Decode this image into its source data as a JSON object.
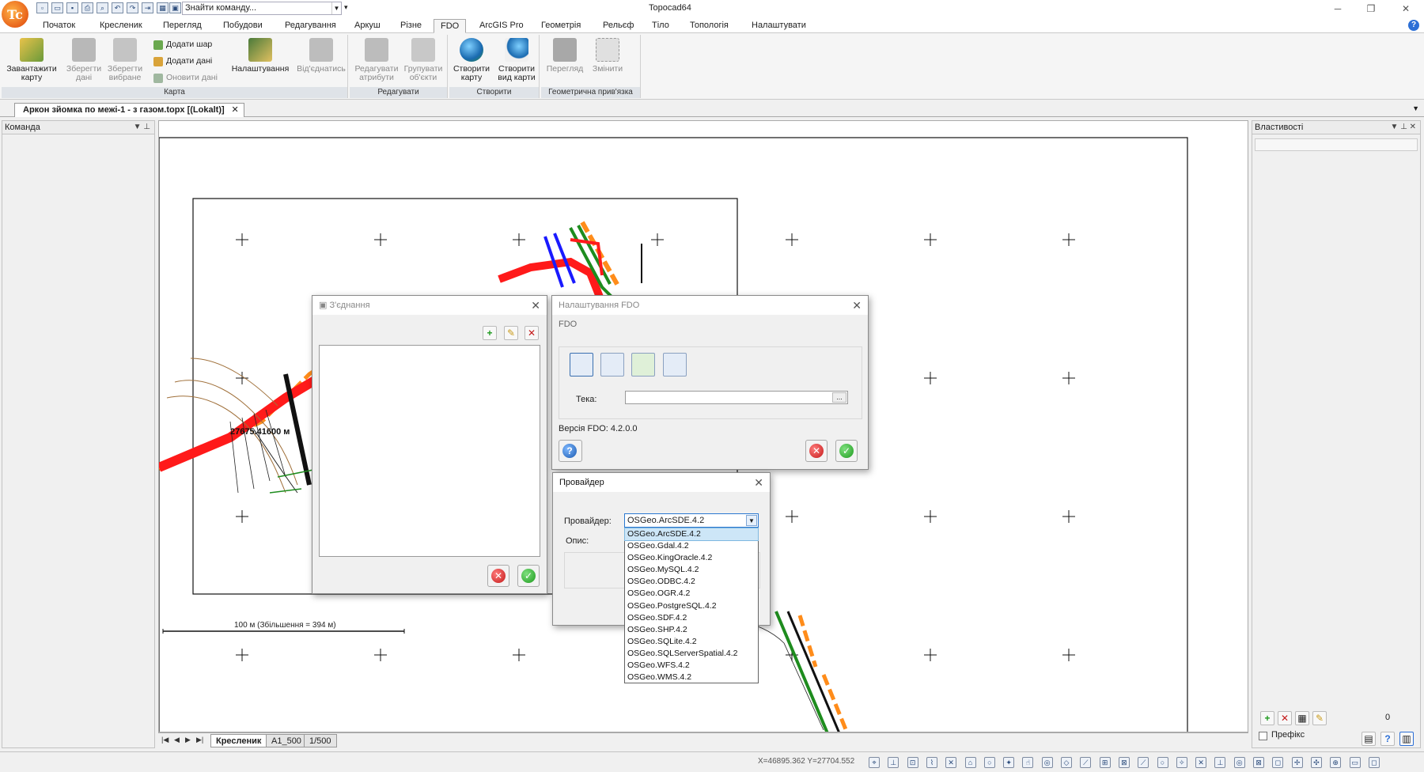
{
  "app": {
    "title": "Topocad64",
    "logo_text": "Tc",
    "search_placeholder": "Знайти команду..."
  },
  "menu": [
    "Початок",
    "Кресленик",
    "Перегляд",
    "Побудови",
    "Редагування",
    "Аркуш",
    "Різне",
    "FDO",
    "ArcGIS Pro",
    "Геометрія",
    "Рельєф",
    "Тіло",
    "Топологія",
    "Налаштувати"
  ],
  "ribbon": {
    "karta": {
      "caption": "Карта",
      "load": "Завантажити карту",
      "save_data": "Зберегти дані",
      "save_selected": "Зберегти вибране",
      "add_layer": "Додати шар",
      "add_data": "Додати дані",
      "refresh_data": "Оновити дані",
      "settings": "Налаштування",
      "disconnect": "Від'єднатись"
    },
    "edit": {
      "caption": "Редагувати",
      "edit_attrs": "Редагувати атрибути",
      "group_objects": "Групувати об'єкти"
    },
    "create": {
      "caption": "Створити",
      "create_map": "Створити карту",
      "create_map_view": "Створити вид карти"
    },
    "georef": {
      "caption": "Геометрична прив'язка",
      "view": "Перегляд",
      "change": "Змінити"
    }
  },
  "document_tab": "Аркон зйомка по межі-1 - з газом.topx [(Lokalt)]",
  "left_panel": {
    "title": "Команда"
  },
  "right_panel": {
    "title": "Властивості",
    "count": "0",
    "prefix_label": "Префікс"
  },
  "canvas": {
    "scale_text": "100 м (Збільшення = 394 м)",
    "annotation": "27675.41600 м",
    "sheet_tabs": [
      "Кресленик",
      "A1_500",
      "1/500"
    ]
  },
  "status": {
    "coords": "X=46895.362 Y=27704.552"
  },
  "dialog_connections": {
    "title": "З'єднання"
  },
  "dialog_fdo": {
    "title": "Налаштування FDO",
    "section": "FDO",
    "folder_label": "Тека:",
    "folder_value": "",
    "browse": "...",
    "version": "Версія FDO: 4.2.0.0"
  },
  "dialog_provider": {
    "title": "Провайдер",
    "provider_label": "Провайдер:",
    "description_label": "Опис:",
    "selected": "OSGeo.ArcSDE.4.2",
    "options": [
      "OSGeo.ArcSDE.4.2",
      "OSGeo.Gdal.4.2",
      "OSGeo.KingOracle.4.2",
      "OSGeo.MySQL.4.2",
      "OSGeo.ODBC.4.2",
      "OSGeo.OGR.4.2",
      "OSGeo.PostgreSQL.4.2",
      "OSGeo.SDF.4.2",
      "OSGeo.SHP.4.2",
      "OSGeo.SQLite.4.2",
      "OSGeo.SQLServerSpatial.4.2",
      "OSGeo.WFS.4.2",
      "OSGeo.WMS.4.2"
    ]
  },
  "colors": {
    "accent": "#2b78d0",
    "ok": "#1e9a1e",
    "cancel": "#c41a1a",
    "red_line": "#ff1a1a",
    "orange_line": "#ff8c1a",
    "blue_line": "#1a1aff",
    "green_line": "#1e8c1e"
  }
}
